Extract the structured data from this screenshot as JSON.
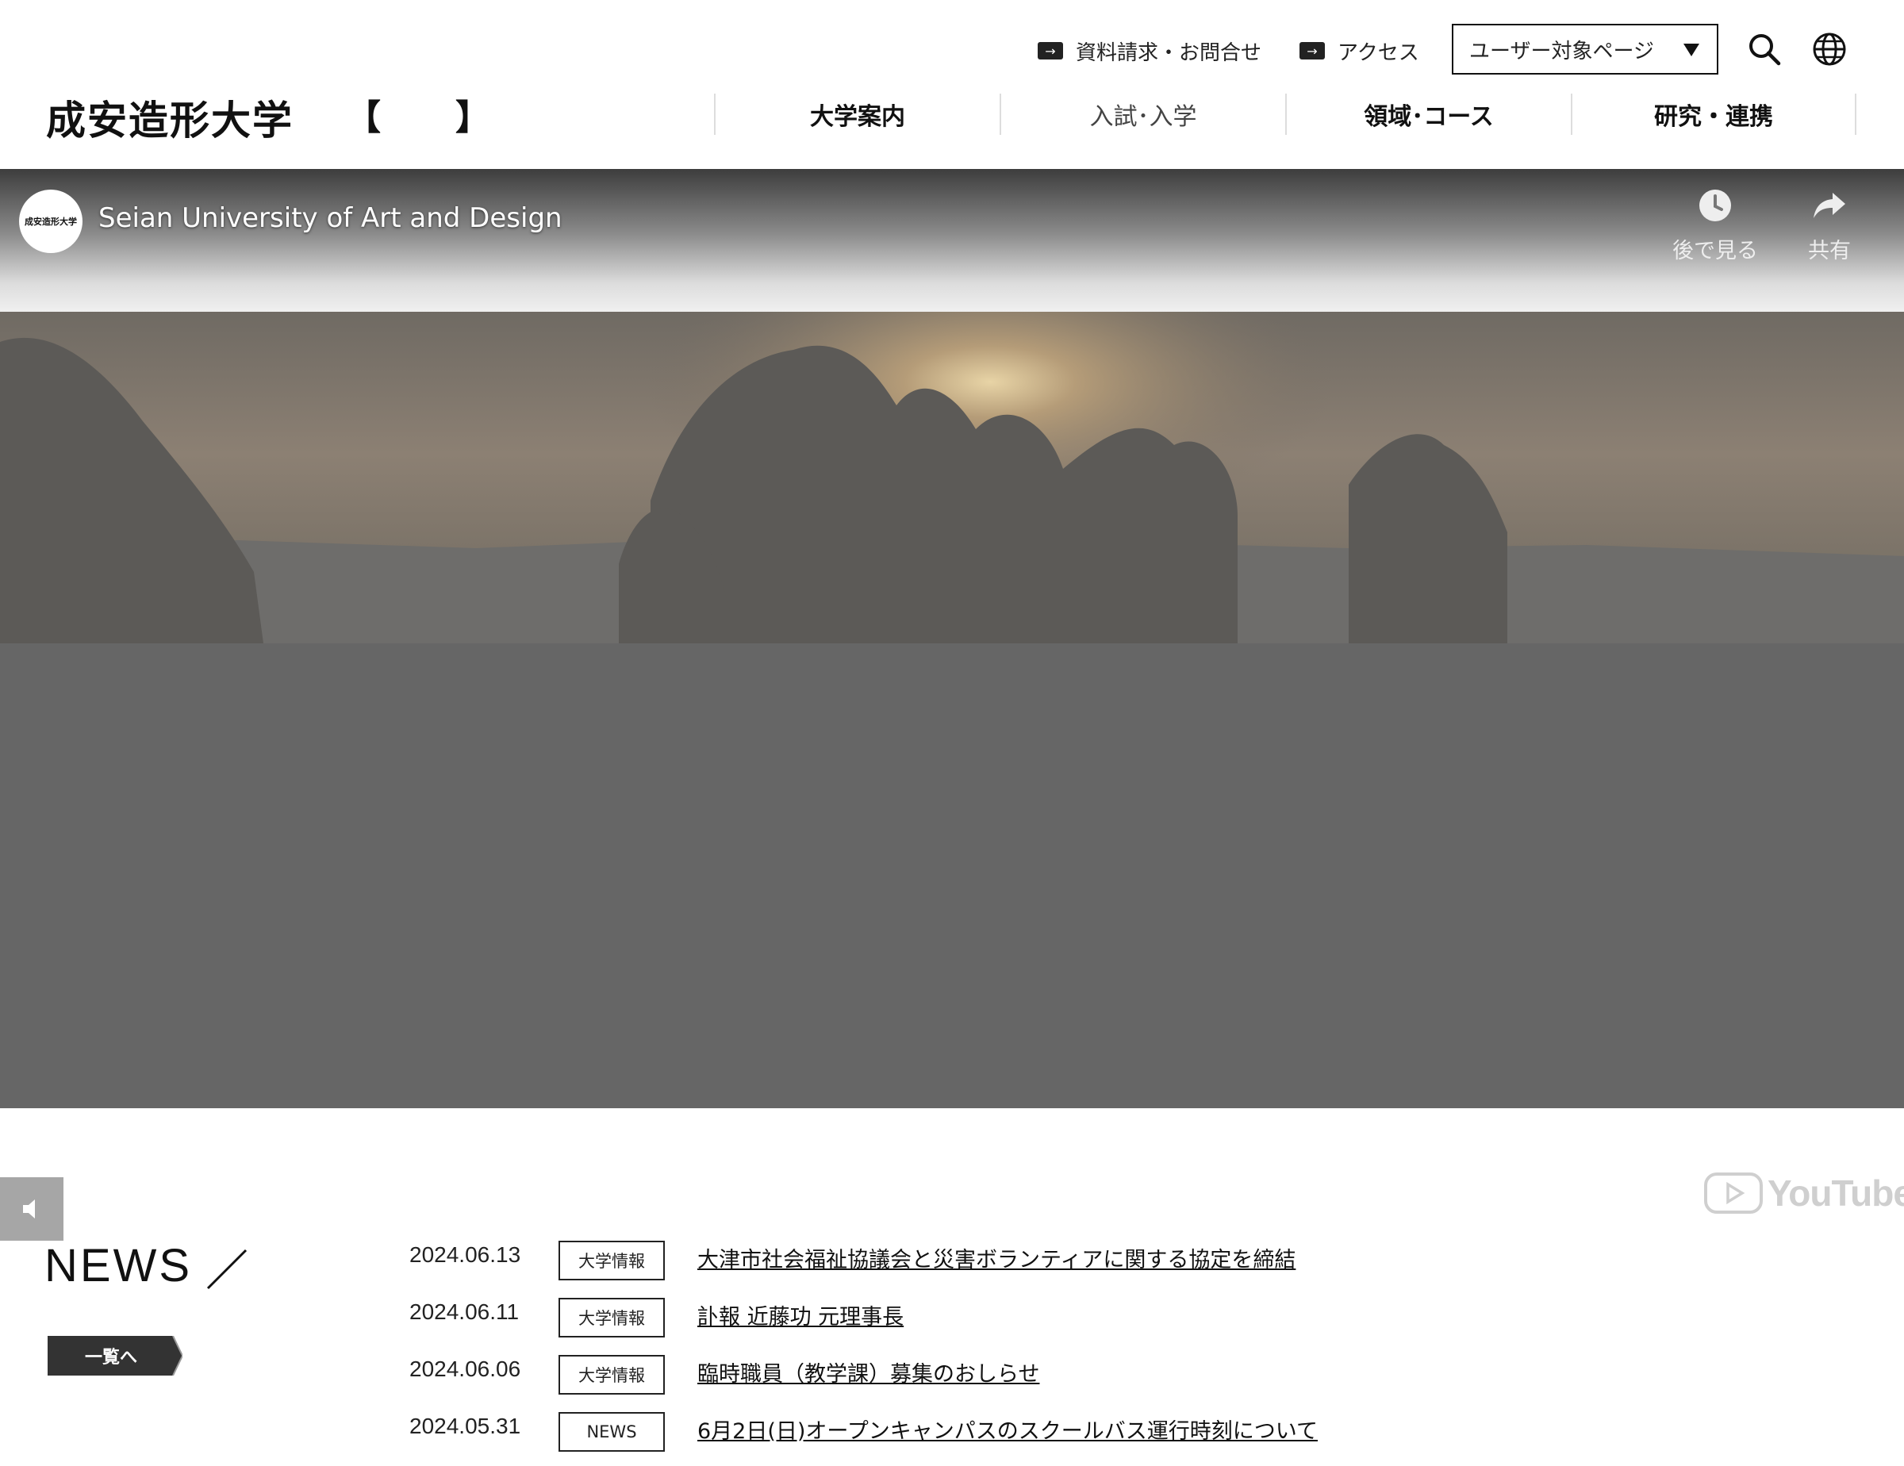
{
  "header": {
    "logo_text": "成安造形大学",
    "logo_bracket_open": "【",
    "logo_bracket_close": "】",
    "utility_links": [
      {
        "label": "資料請求・お問合せ",
        "arrow": "→"
      },
      {
        "label": "アクセス",
        "arrow": "→"
      }
    ],
    "user_select_value": "ユーザー対象ページ",
    "icons": [
      "search-icon",
      "globe-icon"
    ],
    "nav": [
      "大学案内",
      "入試･入学",
      "領域･コース",
      "研究・連携"
    ]
  },
  "video": {
    "channel_logo_text": "成安造形大学",
    "channel_title": "Seian University of Art and Design",
    "watch_later_label": "後で見る",
    "share_label": "共有",
    "youtube_wordmark": "YouTube"
  },
  "news": {
    "title": "NEWS",
    "more_label": "一覧へ",
    "items": [
      {
        "date": "2024.06.13",
        "tag": "大学情報",
        "title": "大津市社会福祉協議会と災害ボランティアに関する協定を締結"
      },
      {
        "date": "2024.06.11",
        "tag": "大学情報",
        "title": "訃報 近藤功 元理事長"
      },
      {
        "date": "2024.06.06",
        "tag": "大学情報",
        "title": "臨時職員（教学課）募集のおしらせ"
      },
      {
        "date": "2024.05.31",
        "tag": "NEWS",
        "title": "6月2日(日)オープンキャンパスのスクールバス運行時刻について"
      }
    ]
  },
  "colors": {
    "text": "#111111",
    "video_overlay": "#666666",
    "mute_button_bg": "#a6a6a6",
    "more_button_bg": "#333333"
  }
}
